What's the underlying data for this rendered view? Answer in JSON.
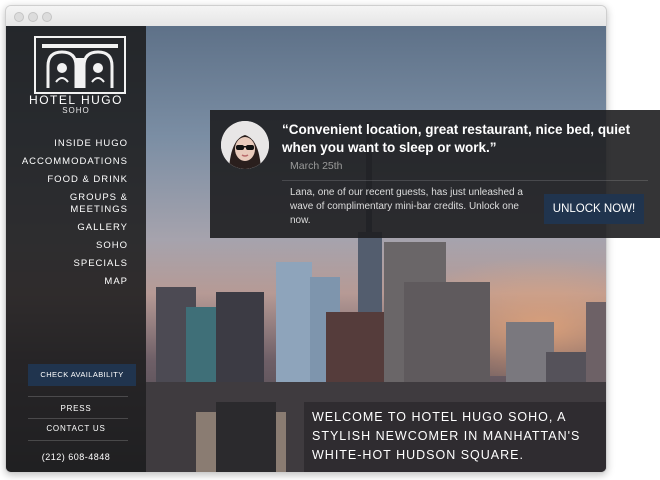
{
  "hotel": {
    "name": "HOTEL HUGO",
    "location": "SOHO"
  },
  "nav": {
    "items": [
      {
        "label": "INSIDE HUGO"
      },
      {
        "label": "ACCOMMODATIONS"
      },
      {
        "label": "FOOD & DRINK"
      },
      {
        "label": "GROUPS & MEETINGS"
      },
      {
        "label": "GALLERY"
      },
      {
        "label": "SOHO"
      },
      {
        "label": "SPECIALS"
      },
      {
        "label": "MAP"
      }
    ]
  },
  "sidebar": {
    "check_availability": "CHECK AVAILABILITY",
    "press": "PRESS",
    "contact": "CONTACT US",
    "phone": "(212) 608-4848"
  },
  "welcome": "WELCOME TO HOTEL HUGO SOHO, A STYLISH NEWCOMER IN MANHATTAN'S WHITE-HOT HUDSON SQUARE.",
  "popup": {
    "quote": "“Convenient location, great restaurant, nice bed, quiet when you want to sleep or work.”",
    "date": "March 25th",
    "description": "Lana, one of our recent guests, has just unleashed a wave of complimentary mini-bar credits. Unlock one now.",
    "button": "UNLOCK NOW!"
  },
  "colors": {
    "sidebar": "#1c1c1e",
    "button_navy": "#20344e"
  }
}
